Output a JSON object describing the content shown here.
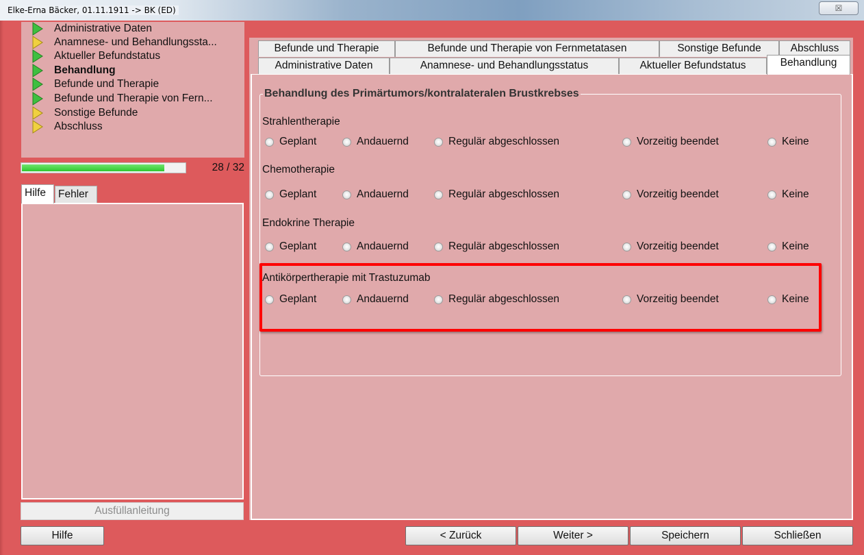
{
  "window": {
    "title": "Elke-Erna Bäcker, 01.11.1911 -> BK (ED)",
    "close_glyph": "☒"
  },
  "colors": {
    "frame": "#dd5a5c",
    "panel": "#e0a9ab",
    "arrow_green": "#3fbf3f",
    "arrow_yellow": "#f0d040",
    "progress_green": "#2ec82e",
    "highlight": "#ff0000"
  },
  "nav": {
    "items": [
      {
        "label": "Administrative Daten",
        "arrow": "green-arrow-icon",
        "bold": false
      },
      {
        "label": "Anamnese- und Behandlungssta...",
        "arrow": "yellow-arrow-icon",
        "bold": false
      },
      {
        "label": "Aktueller Befundstatus",
        "arrow": "green-arrow-icon",
        "bold": false
      },
      {
        "label": "Behandlung",
        "arrow": "green-arrow-icon",
        "bold": true
      },
      {
        "label": "Befunde und Therapie",
        "arrow": "green-arrow-icon",
        "bold": false
      },
      {
        "label": "Befunde und Therapie von Fern...",
        "arrow": "green-arrow-icon",
        "bold": false
      },
      {
        "label": "Sonstige Befunde",
        "arrow": "yellow-arrow-icon",
        "bold": false
      },
      {
        "label": "Abschluss",
        "arrow": "yellow-arrow-icon",
        "bold": false
      }
    ]
  },
  "progress": {
    "current": 28,
    "total": 32,
    "text": "28 / 32"
  },
  "help_tabs": [
    "Hilfe",
    "Fehler"
  ],
  "fill_guide_label": "Ausfüllanleitung",
  "tabs": {
    "row1": [
      "Befunde und Therapie",
      "Befunde und Therapie von Fernmetatasen",
      "Sonstige Befunde",
      "Abschluss"
    ],
    "row2": [
      "Administrative Daten",
      "Anamnese- und Behandlungsstatus",
      "Aktueller Befundstatus",
      "Behandlung"
    ],
    "active": "Behandlung"
  },
  "group": {
    "title": "Behandlung des Primärtumors/kontralateralen Brustkrebses",
    "options": [
      "Geplant",
      "Andauernd",
      "Regulär abgeschlossen",
      "Vorzeitig beendet",
      "Keine"
    ],
    "sections": [
      {
        "title": "Strahlentherapie",
        "selected": null
      },
      {
        "title": "Chemotherapie",
        "selected": null
      },
      {
        "title": "Endokrine Therapie",
        "selected": null
      },
      {
        "title": "Antikörpertherapie mit Trastuzumab",
        "selected": null
      }
    ]
  },
  "buttons": {
    "help": "Hilfe",
    "back": "< Zurück",
    "next": "Weiter >",
    "save": "Speichern",
    "close": "Schließen"
  }
}
